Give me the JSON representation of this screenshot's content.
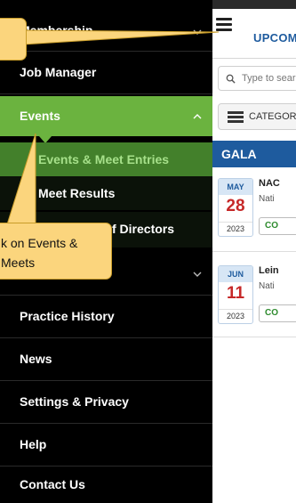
{
  "page": {
    "title": "UPCOM",
    "search_placeholder": "Type to sear",
    "category_label": "CATEGOR",
    "section_label": "GALA",
    "events": [
      {
        "month": "MAY",
        "day": "28",
        "year": "2023",
        "title": "NAC",
        "subtitle": "Nati",
        "badge": "CO",
        "day_color": "#c62828"
      },
      {
        "month": "JUN",
        "day": "11",
        "year": "2023",
        "title": "Lein",
        "subtitle": "Nati",
        "badge": "CO",
        "day_color": "#c62828"
      }
    ]
  },
  "drawer": {
    "items": {
      "membership": "Membership",
      "job_manager": "Job Manager",
      "events": "Events",
      "events_meet_entries": "Events & Meet Entries",
      "meet_results": "Meet Results",
      "board_of_directors": "f Directors",
      "practice_history": "Practice History",
      "news": "News",
      "settings_privacy": "Settings & Privacy",
      "help": "Help",
      "contact_us": "Contact Us"
    }
  },
  "callouts": {
    "hint": "k on Events &\n    Meets"
  },
  "colors": {
    "drawer_bg": "#000000",
    "active_green": "#6bb33f",
    "sub_active_green": "#43802b",
    "brand_blue": "#1e5b9e",
    "callout_bg": "#fbd57d"
  }
}
